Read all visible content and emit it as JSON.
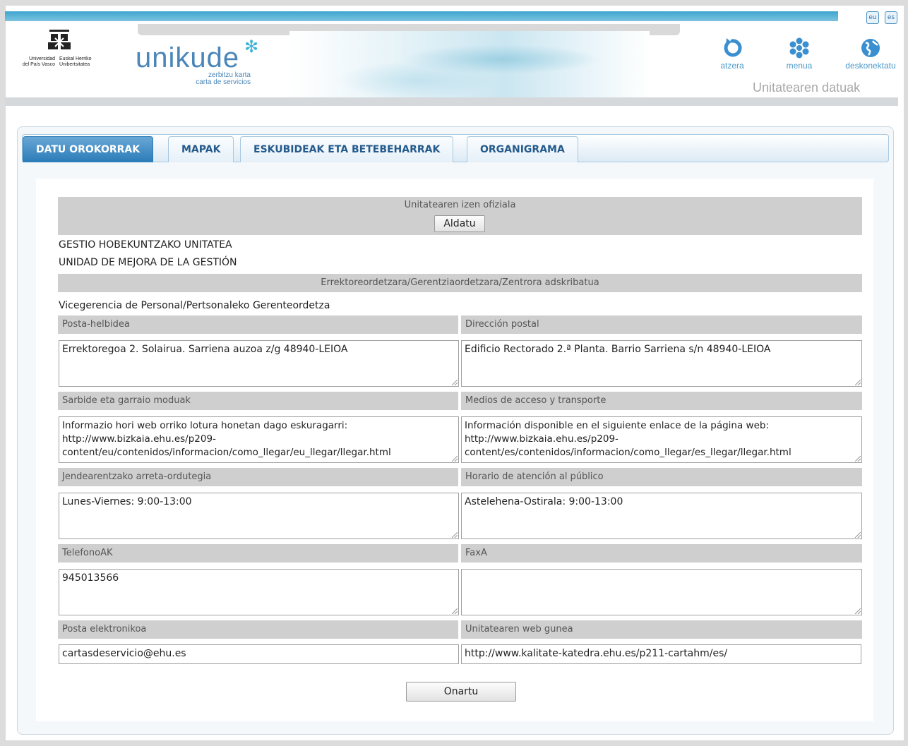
{
  "header": {
    "lang": [
      "eu",
      "es"
    ],
    "ehu_left": "Universidad\ndel País Vasco",
    "ehu_right": "Euskal Herriko\nUnibertsitatea",
    "brand": "unikude",
    "brand_star": "✻",
    "brand_sub1": "zerbitzu karta",
    "brand_sub2": "carta de servicios",
    "nav": [
      {
        "label": "atzera",
        "icon": "back-arrow-icon"
      },
      {
        "label": "menua",
        "icon": "asterisk-menu-icon"
      },
      {
        "label": "deskonektatu",
        "icon": "globe-icon"
      }
    ],
    "page_heading": "Unitatearen datuak",
    "colors": {
      "accent": "#4a9ac8",
      "brand": "#4a86b8",
      "tab_active": "#2a7bb8"
    }
  },
  "tabs": [
    {
      "label": "DATU OROKORRAK",
      "active": true
    },
    {
      "label": "MAPAK",
      "active": false
    },
    {
      "label": "ESKUBIDEAK ETA BETEBEHARRAK",
      "active": false
    },
    {
      "label": "ORGANIGRAMA",
      "active": false
    }
  ],
  "form": {
    "official_name_header": "Unitatearen izen ofiziala",
    "change_button": "Aldatu",
    "name_eu": "GESTIO HOBEKUNTZAKO UNITATEA",
    "name_es": "UNIDAD DE MEJORA DE LA GESTIÓN",
    "attached_header": "Errektoreordetzara/Gerentziaordetzara/Zentrora adskribatua",
    "attached_value": "Vicegerencia de Personal/Pertsonaleko Gerenteordetza",
    "postal_eu_label": "Posta-helbidea",
    "postal_es_label": "Dirección postal",
    "postal_eu_value": "Errektoregoa 2. Solairua. Sarriena auzoa z/g 48940-LEIOA",
    "postal_es_value": "Edificio Rectorado 2.ª Planta. Barrio Sarriena s/n 48940-LEIOA",
    "access_eu_label": "Sarbide eta garraio moduak",
    "access_es_label": "Medios de acceso y transporte",
    "access_eu_value": "Informazio hori web orriko lotura honetan dago eskuragarri:\nhttp://www.bizkaia.ehu.es/p209-\ncontent/eu/contenidos/informacion/como_llegar/eu_llegar/llegar.html",
    "access_es_value": "Información disponible en el siguiente enlace de la página web:\nhttp://www.bizkaia.ehu.es/p209-\ncontent/es/contenidos/informacion/como_llegar/es_llegar/llegar.html",
    "hours_eu_label": "Jendearentzako arreta-ordutegia",
    "hours_es_label": "Horario de atención al público",
    "hours_eu_value": "Lunes-Viernes: 9:00-13:00",
    "hours_es_value": "Astelehena-Ostirala: 9:00-13:00",
    "phone_label": "TelefonoAK",
    "fax_label": "FaxA",
    "phone_value": "945013566",
    "fax_value": "",
    "email_label": "Posta elektronikoa",
    "web_label": "Unitatearen web gunea",
    "email_value": "cartasdeservicio@ehu.es",
    "web_value": "http://www.kalitate-katedra.ehu.es/p211-cartahm/es/",
    "submit_button": "Onartu"
  }
}
